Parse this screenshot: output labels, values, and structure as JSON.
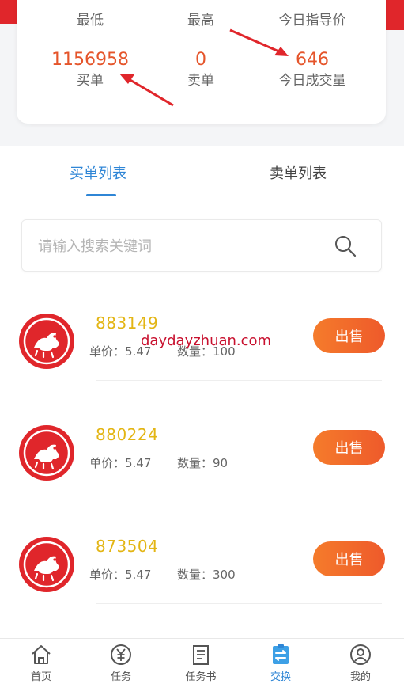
{
  "stats": {
    "lowest_label": "最低",
    "highest_label": "最高",
    "guide_price_label": "今日指导价",
    "buy_value": "1156958",
    "buy_label": "买单",
    "sell_value": "0",
    "sell_label": "卖单",
    "volume_value": "646",
    "volume_label": "今日成交量"
  },
  "tabs": {
    "buy_list": "买单列表",
    "sell_list": "卖单列表"
  },
  "search": {
    "placeholder": "请输入搜索关键词"
  },
  "orders": [
    {
      "code": "883149",
      "price": "单价：5.47",
      "qty": "数量：100",
      "action": "出售"
    },
    {
      "code": "880224",
      "price": "单价：5.47",
      "qty": "数量：90",
      "action": "出售"
    },
    {
      "code": "873504",
      "price": "单价：5.47",
      "qty": "数量：300",
      "action": "出售"
    }
  ],
  "watermark": "daydayzhuan.com",
  "tabbar": [
    {
      "label": "首页",
      "icon": "home-icon"
    },
    {
      "label": "任务",
      "icon": "yuan-icon"
    },
    {
      "label": "任务书",
      "icon": "book-icon"
    },
    {
      "label": "交换",
      "icon": "exchange-icon"
    },
    {
      "label": "我的",
      "icon": "user-icon"
    }
  ],
  "colors": {
    "accent_blue": "#2f86d6",
    "stat_orange": "#e5552b",
    "code_gold": "#e3b514",
    "sell_button": "#f26b2b",
    "brand_red": "#e0262b"
  }
}
